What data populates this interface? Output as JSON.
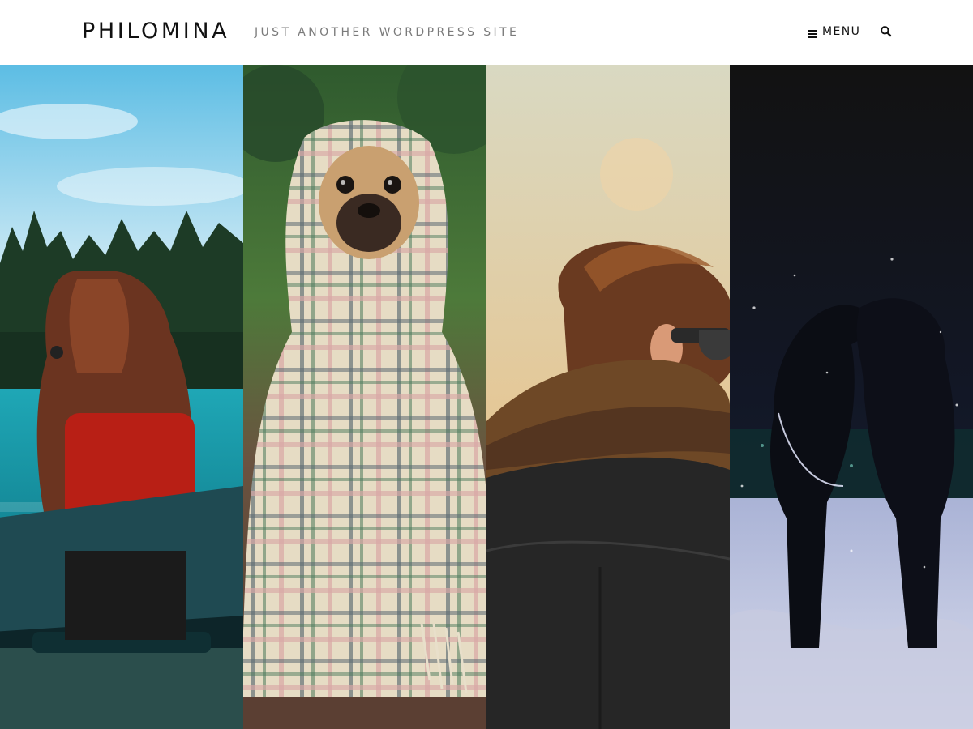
{
  "site": {
    "title": "PHILOMINA",
    "description": "JUST ANOTHER WORDPRESS SITE"
  },
  "nav": {
    "menu_label": "MENU",
    "menu_icon": "hamburger-icon",
    "search_icon": "search-icon"
  },
  "gallery": {
    "items": [
      {
        "subject": "woman-in-canoe-on-lake"
      },
      {
        "subject": "pug-wrapped-in-plaid-blanket"
      },
      {
        "subject": "person-with-scarf-and-sunglasses"
      },
      {
        "subject": "couple-kissing-in-snow-at-night"
      }
    ]
  },
  "colors": {
    "title": "#111111",
    "tagline": "#7b7b7b",
    "background": "#ffffff"
  }
}
